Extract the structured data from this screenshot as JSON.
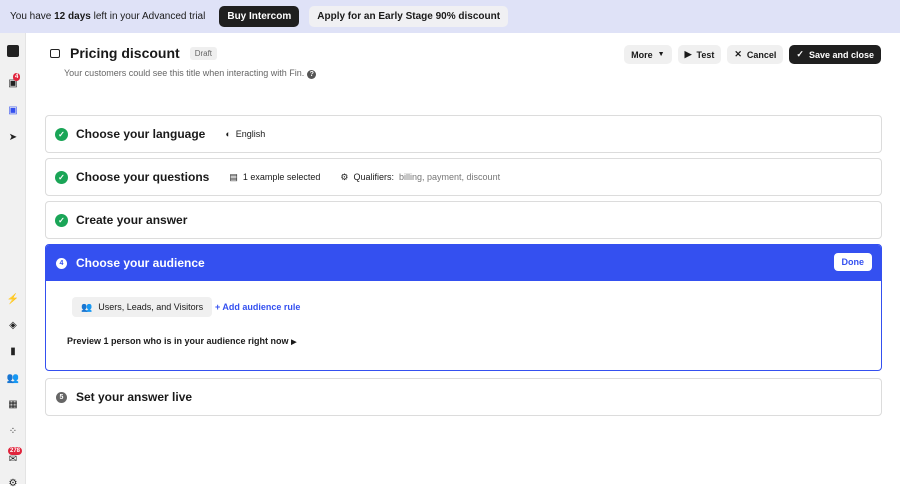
{
  "banner": {
    "text_pre": "You have ",
    "days": "12 days",
    "text_post": " left in your Advanced trial",
    "buy": "Buy Intercom",
    "apply": "Apply for an Early Stage 90% discount"
  },
  "sidebar": {
    "inbox_badge": "4",
    "tickets_badge": "278"
  },
  "header": {
    "title": "Pricing discount",
    "status": "Draft",
    "subtitle": "Your customers could see this title when interacting with Fin.",
    "help": "?"
  },
  "actions": {
    "more": "More",
    "test": "Test",
    "cancel": "Cancel",
    "save": "Save and close"
  },
  "steps": [
    {
      "title": "Choose your language",
      "meta": "English"
    },
    {
      "title": "Choose your questions",
      "examples": "1 example selected",
      "qualifiers_label": "Qualifiers:",
      "qualifiers": "billing, payment, discount"
    },
    {
      "title": "Create your answer"
    },
    {
      "number": "4",
      "title": "Choose your audience",
      "done": "Done",
      "audience": "Users, Leads, and Visitors",
      "add_rule": "+ Add audience rule",
      "preview": "Preview 1 person who is in your audience right now"
    },
    {
      "number": "5",
      "title": "Set your answer live"
    }
  ],
  "colors": {
    "accent": "#3450f0",
    "success": "#1aa557",
    "banner": "#dfe2f7"
  }
}
